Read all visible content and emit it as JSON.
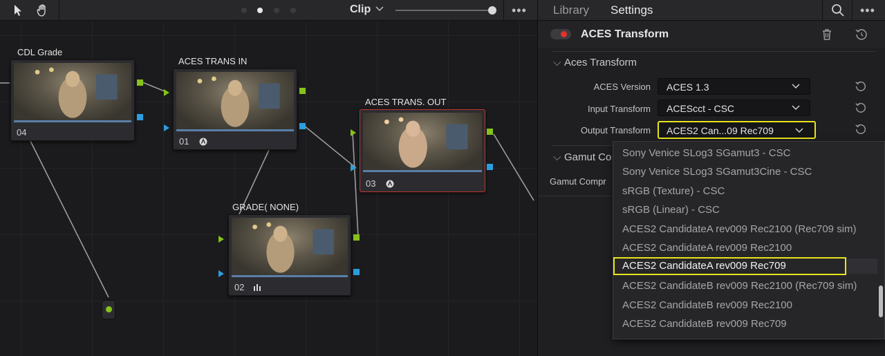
{
  "toolbar": {
    "clip_label": "Clip"
  },
  "nodes": {
    "cdl": {
      "label": "CDL Grade",
      "number": "04"
    },
    "trans_in": {
      "label": "ACES TRANS IN",
      "number": "01"
    },
    "trans_out": {
      "label": "ACES TRANS. OUT",
      "number": "03"
    },
    "grade": {
      "label": "GRADE( NONE)",
      "number": "02"
    }
  },
  "panel": {
    "tabs": {
      "library": "Library",
      "settings": "Settings"
    },
    "header_title": "ACES Transform",
    "section1_title": "Aces Transform",
    "section2_title_partial": "Gamut Co",
    "gamut_label_partial": "Gamut Compr",
    "properties": {
      "version": {
        "label": "ACES Version",
        "value": "ACES 1.3"
      },
      "input": {
        "label": "Input Transform",
        "value": "ACEScct - CSC"
      },
      "output": {
        "label": "Output Transform",
        "value": "ACES2 Can...09 Rec709"
      }
    }
  },
  "dropdown": {
    "items": [
      "Sony Venice SLog3 SGamut3 - CSC",
      "Sony Venice SLog3 SGamut3Cine - CSC",
      "sRGB (Texture) - CSC",
      "sRGB (Linear) - CSC",
      "ACES2 CandidateA rev009 Rec2100 (Rec709 sim)",
      "ACES2 CandidateA rev009 Rec2100",
      "ACES2 CandidateA rev009 Rec709",
      "ACES2 CandidateB rev009 Rec2100 (Rec709 sim)",
      "ACES2 CandidateB rev009 Rec2100",
      "ACES2 CandidateB rev009 Rec709"
    ],
    "selected_index": 6
  },
  "colors": {
    "accent_red": "#d33a30",
    "highlight_yellow": "#e8e41c",
    "port_green": "#86c21a",
    "port_blue": "#2b9ee0"
  }
}
